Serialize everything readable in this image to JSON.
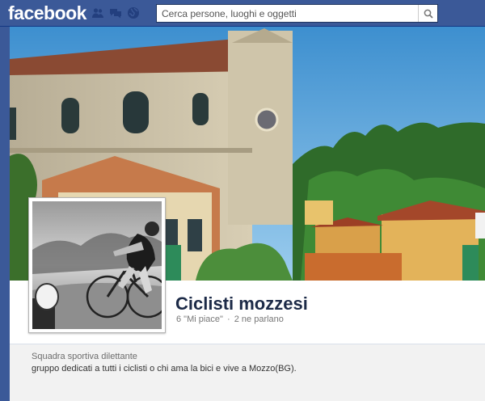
{
  "topbar": {
    "logo_text": "facebook",
    "search": {
      "placeholder": "Cerca persone, luoghi e oggetti"
    },
    "icons": [
      "friend-requests-icon",
      "messages-icon",
      "notifications-icon",
      "search-icon"
    ]
  },
  "page": {
    "name": "Ciclisti mozzesi",
    "likes": "6 \"Mi piace\"",
    "separator": "·",
    "talking": "2 ne parlano",
    "category": "Squadra sportiva dilettante",
    "description": "gruppo dedicati a tutti i ciclisti o chi ama la bici e vive a Mozzo(BG)."
  },
  "colors": {
    "brand_blue": "#3b5998",
    "page_name": "#1c2a47",
    "about_bg": "#f2f2f2"
  }
}
